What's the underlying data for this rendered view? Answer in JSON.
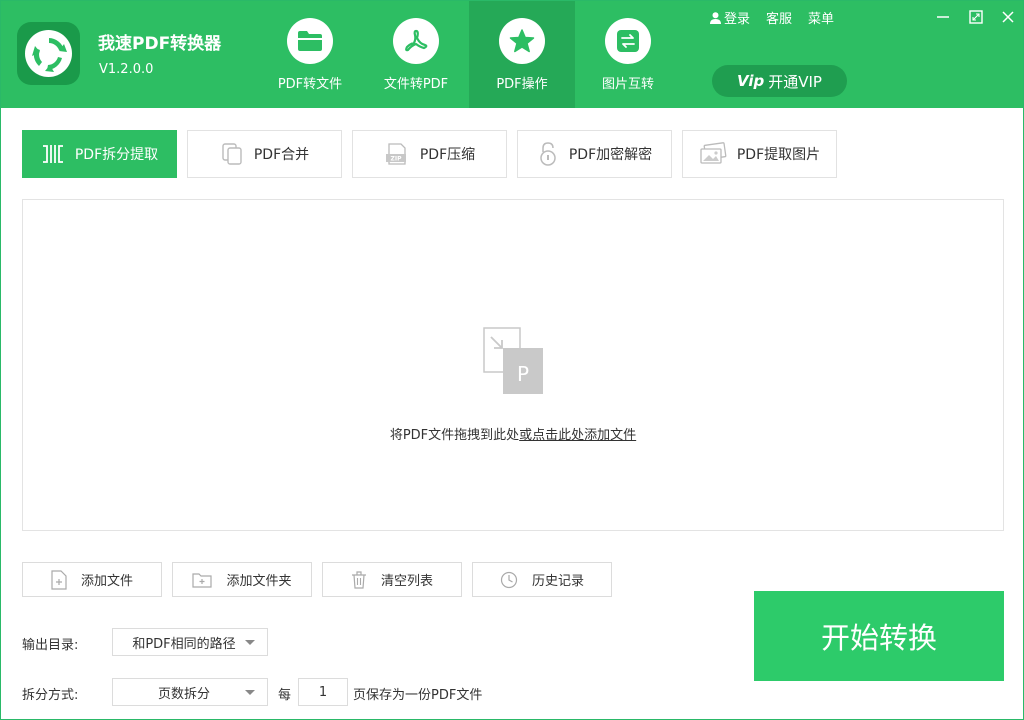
{
  "app": {
    "title": "我速PDF转换器",
    "version": "V1.2.0.0"
  },
  "nav": [
    {
      "label": "PDF转文件",
      "icon": "folder-icon",
      "active": false
    },
    {
      "label": "文件转PDF",
      "icon": "pdf-icon",
      "active": false
    },
    {
      "label": "PDF操作",
      "icon": "star-icon",
      "active": true
    },
    {
      "label": "图片互转",
      "icon": "swap-icon",
      "active": false
    }
  ],
  "top_links": {
    "login": "登录",
    "service": "客服",
    "menu": "菜单"
  },
  "vip": {
    "badge": "Vip",
    "label": "开通VIP"
  },
  "subtabs": [
    {
      "label": "PDF拆分提取",
      "icon": "split-icon",
      "active": true
    },
    {
      "label": "PDF合并",
      "icon": "merge-icon",
      "active": false
    },
    {
      "label": "PDF压缩",
      "icon": "zip-icon",
      "active": false
    },
    {
      "label": "PDF加密解密",
      "icon": "lock-icon",
      "active": false
    },
    {
      "label": "PDF提取图片",
      "icon": "image-icon",
      "active": false
    }
  ],
  "dropzone": {
    "text": "将PDF文件拖拽到此处",
    "link": "或点击此处添加文件"
  },
  "actions": {
    "add_file": "添加文件",
    "add_folder": "添加文件夹",
    "clear_list": "清空列表",
    "history": "历史记录"
  },
  "settings": {
    "output_label": "输出目录:",
    "output_value": "和PDF相同的路径",
    "split_label": "拆分方式:",
    "split_value": "页数拆分",
    "every_prefix": "每",
    "every_value": "1",
    "every_suffix": "页保存为一份PDF文件"
  },
  "start_button": "开始转换",
  "colors": {
    "brand_green": "#2dbe63",
    "active_nav": "#25a957",
    "start_green": "#2dcb6a"
  }
}
